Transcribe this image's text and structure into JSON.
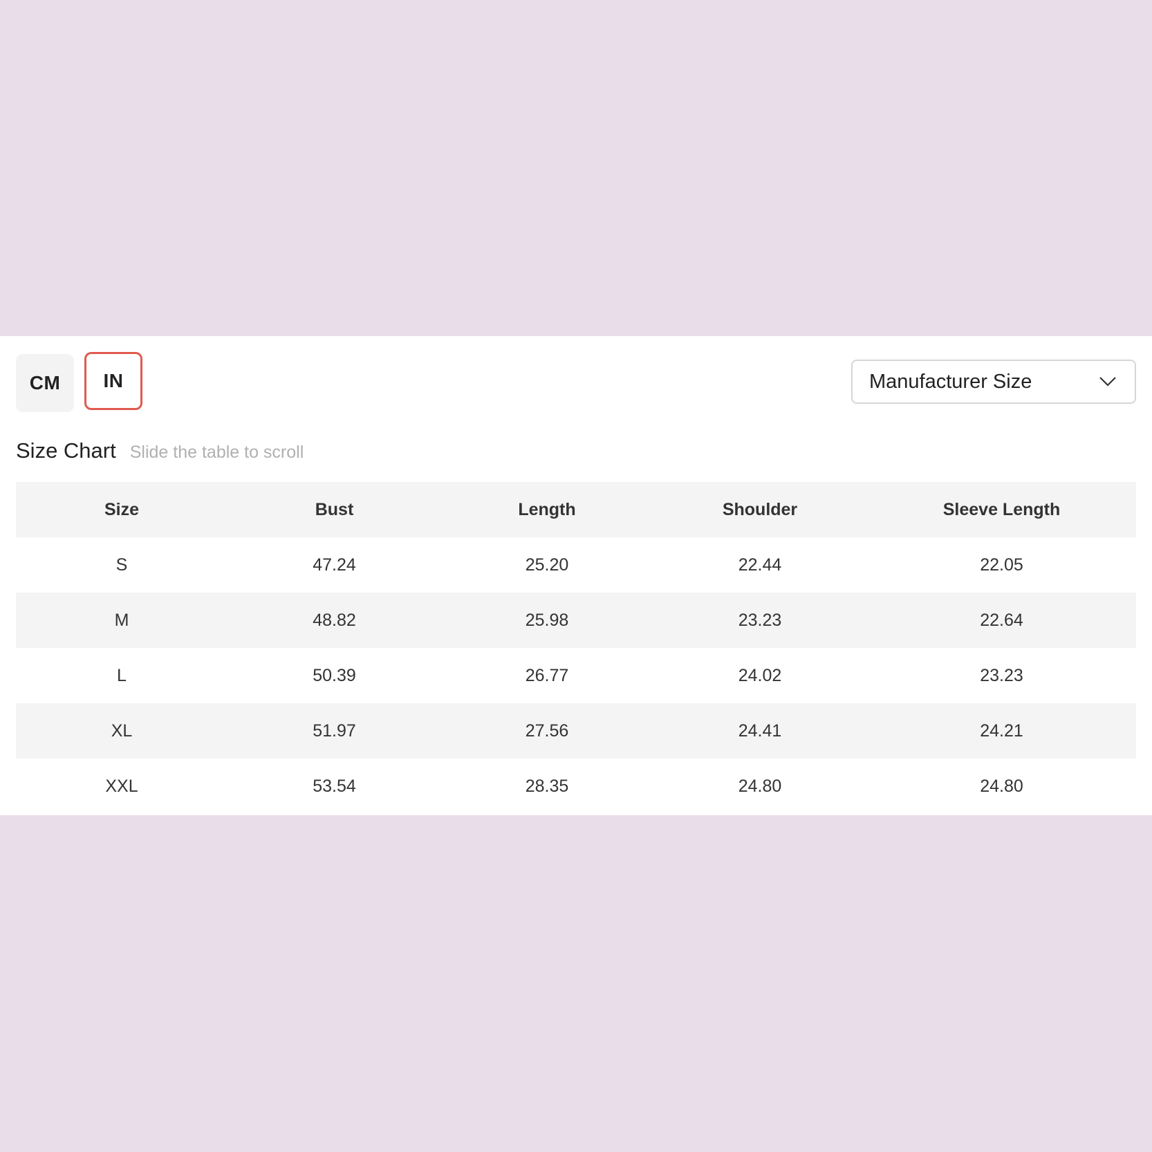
{
  "units": {
    "cm_label": "CM",
    "in_label": "IN",
    "selected": "IN"
  },
  "size_select": {
    "value": "Manufacturer Size"
  },
  "size_chart": {
    "title": "Size Chart",
    "hint": "Slide the table to scroll",
    "headers": [
      "Size",
      "Bust",
      "Length",
      "Shoulder",
      "Sleeve Length"
    ],
    "rows": [
      [
        "S",
        "47.24",
        "25.20",
        "22.44",
        "22.05"
      ],
      [
        "M",
        "48.82",
        "25.98",
        "23.23",
        "22.64"
      ],
      [
        "L",
        "50.39",
        "26.77",
        "24.02",
        "23.23"
      ],
      [
        "XL",
        "51.97",
        "27.56",
        "24.41",
        "24.21"
      ],
      [
        "XXL",
        "53.54",
        "28.35",
        "24.80",
        "24.80"
      ]
    ]
  },
  "colors": {
    "background": "#e8dde9",
    "accent": "#e05a4f"
  }
}
